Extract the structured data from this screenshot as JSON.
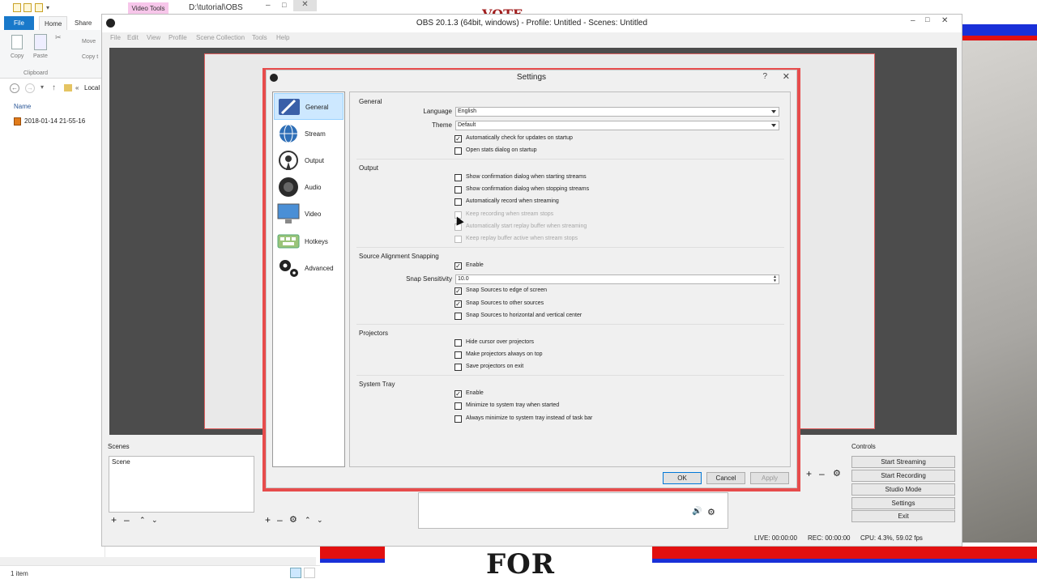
{
  "explorer": {
    "video_tools_tab": "Video Tools",
    "path": "D:\\tutorial\\OBS",
    "tabs": [
      "File",
      "Home",
      "Share"
    ],
    "ribbon": {
      "copy": "Copy",
      "paste": "Paste",
      "move": "Move",
      "copy_to": "Copy t",
      "clipboard": "Clipboard"
    },
    "location": "Local",
    "column_name": "Name",
    "file": "2018-01-14 21-55-16",
    "status": "1 item"
  },
  "obs": {
    "title": "OBS 20.1.3 (64bit, windows) - Profile: Untitled - Scenes: Untitled",
    "menu": [
      "File",
      "Edit",
      "View",
      "Profile",
      "Scene Collection",
      "Tools",
      "Help"
    ],
    "scenes_label": "Scenes",
    "scene_item": "Scene",
    "controls_label": "Controls",
    "controls": [
      "Start Streaming",
      "Start Recording",
      "Studio Mode",
      "Settings",
      "Exit"
    ],
    "status": {
      "live": "LIVE: 00:00:00",
      "rec": "REC: 00:00:00",
      "cpu": "CPU: 4.3%, 59.02 fps"
    }
  },
  "banners": {
    "bottom": "FOR EVERYONE",
    "top": "VOTE"
  },
  "settings": {
    "title": "Settings",
    "help": "?",
    "categories": [
      "General",
      "Stream",
      "Output",
      "Audio",
      "Video",
      "Hotkeys",
      "Advanced"
    ],
    "general_group": "General",
    "language_label": "Language",
    "language_value": "English",
    "theme_label": "Theme",
    "theme_value": "Default",
    "auto_update": "Automatically check for updates on startup",
    "stats_startup": "Open stats dialog on startup",
    "output_group": "Output",
    "confirm_start": "Show confirmation dialog when starting streams",
    "confirm_stop": "Show confirmation dialog when stopping streams",
    "auto_record": "Automatically record when streaming",
    "keep_recording": "Keep recording when stream stops",
    "auto_replay": "Automatically start replay buffer when streaming",
    "keep_replay": "Keep replay buffer active when stream stops",
    "snap_group": "Source Alignment Snapping",
    "snap_enable": "Enable",
    "snap_sens_label": "Snap Sensitivity",
    "snap_sens_value": "10.0",
    "snap_edge": "Snap Sources to edge of screen",
    "snap_other": "Snap Sources to other sources",
    "snap_center": "Snap Sources to horizontal and vertical center",
    "proj_group": "Projectors",
    "hide_cursor": "Hide cursor over projectors",
    "proj_top": "Make projectors always on top",
    "proj_save": "Save projectors on exit",
    "tray_group": "System Tray",
    "tray_enable": "Enable",
    "tray_min_start": "Minimize to system tray when started",
    "tray_always": "Always minimize to system tray instead of task bar",
    "ok": "OK",
    "cancel": "Cancel",
    "apply": "Apply"
  }
}
